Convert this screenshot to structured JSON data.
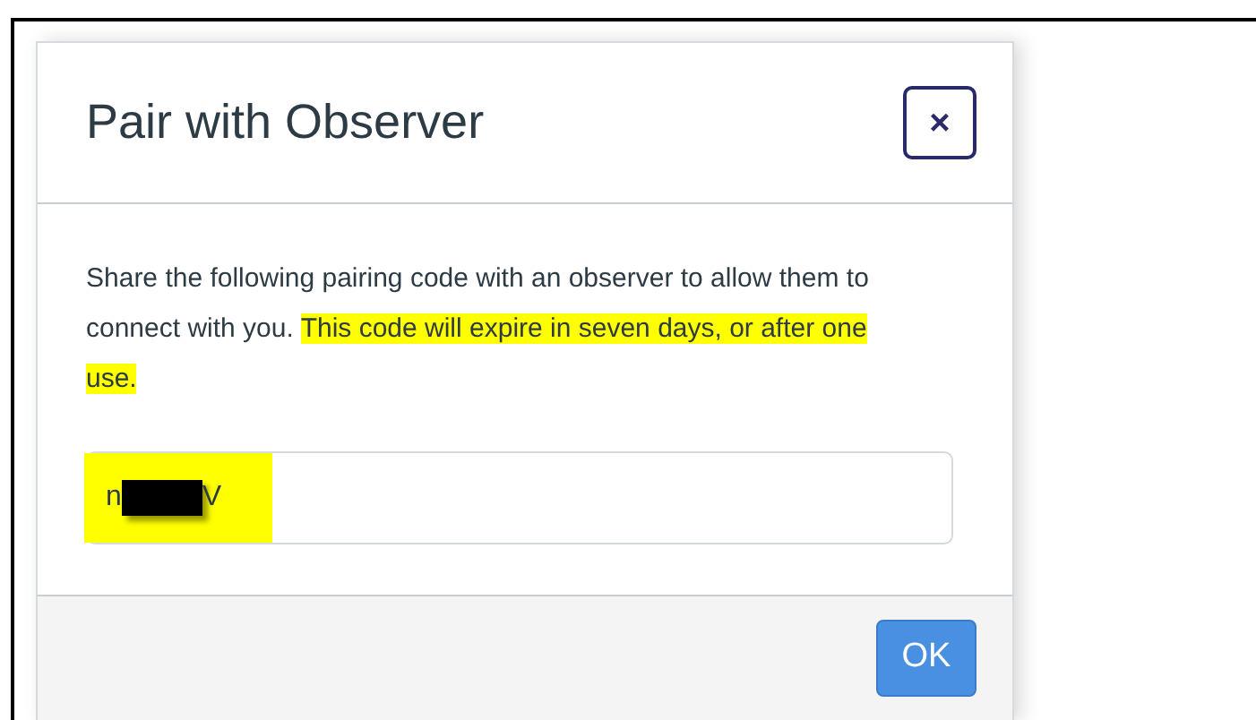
{
  "dialog": {
    "title": "Pair with Observer",
    "close_label": "×",
    "message": {
      "text": "Share the following pairing code with an observer to allow them to connect with you.",
      "highlight": "This code will expire in seven days, or after one use."
    },
    "code_field": {
      "prefix": "n",
      "suffix": "V",
      "redacted": true,
      "highlighted": true
    },
    "buttons": [
      "OK"
    ]
  }
}
